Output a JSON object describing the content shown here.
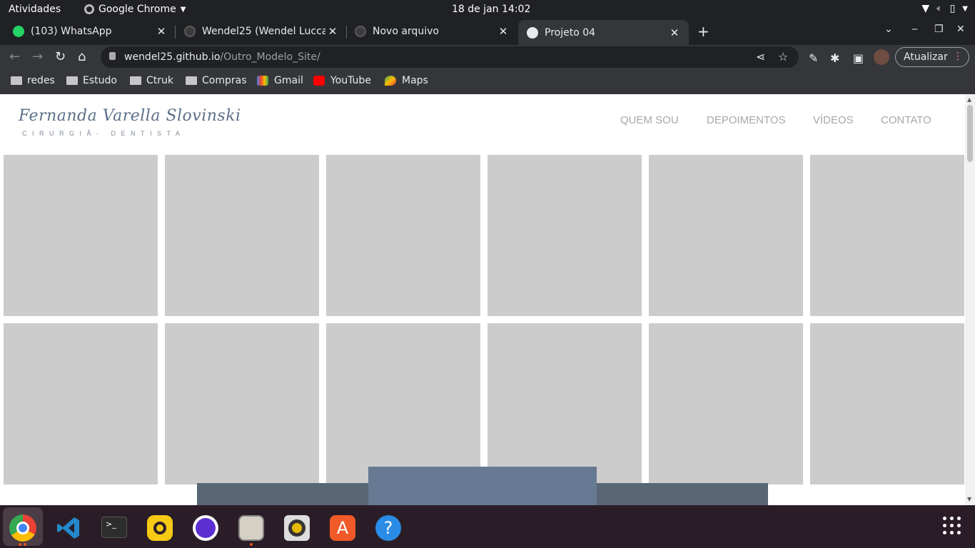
{
  "topbar": {
    "activities": "Atividades",
    "app_name": "Google Chrome",
    "clock": "18 de jan  14:02"
  },
  "tabs": [
    {
      "label": "(103) WhatsApp",
      "icon": "whatsapp-icon",
      "active": false
    },
    {
      "label": "Wendel25 (Wendel Lucca)",
      "icon": "github-icon",
      "active": false
    },
    {
      "label": "Novo arquivo",
      "icon": "github-icon",
      "active": false
    },
    {
      "label": "Projeto 04",
      "icon": "globe-icon",
      "active": true
    }
  ],
  "omnibox": {
    "host": "wendel25.github.io",
    "path": "/Outro_Modelo_Site/"
  },
  "toolbar": {
    "update_label": "Atualizar"
  },
  "bookmarks": [
    {
      "label": "redes",
      "icon": "folder-icon"
    },
    {
      "label": "Estudo",
      "icon": "folder-icon"
    },
    {
      "label": "Ctruk",
      "icon": "folder-icon"
    },
    {
      "label": "Compras",
      "icon": "folder-icon"
    },
    {
      "label": "Gmail",
      "icon": "gmail-icon"
    },
    {
      "label": "YouTube",
      "icon": "youtube-icon"
    },
    {
      "label": "Maps",
      "icon": "maps-icon"
    }
  ],
  "site": {
    "logo_name": "Fernanda Varella Slovinski",
    "logo_sub": "CIRURGIÃ- DENTISTA",
    "nav": [
      "QUEM SOU",
      "DEPOIMENTOS",
      "VÍDEOS",
      "CONTATO"
    ]
  },
  "dock": [
    "chrome-icon",
    "vscode-icon",
    "terminal-icon",
    "beekeeper-icon",
    "tor-icon",
    "files-icon",
    "rhythmbox-icon",
    "software-center-icon",
    "help-icon"
  ],
  "colors": {
    "tile": "#cccccc",
    "logo": "#5c7088",
    "footer_bar": "#586676",
    "footer_box": "#677a93"
  }
}
